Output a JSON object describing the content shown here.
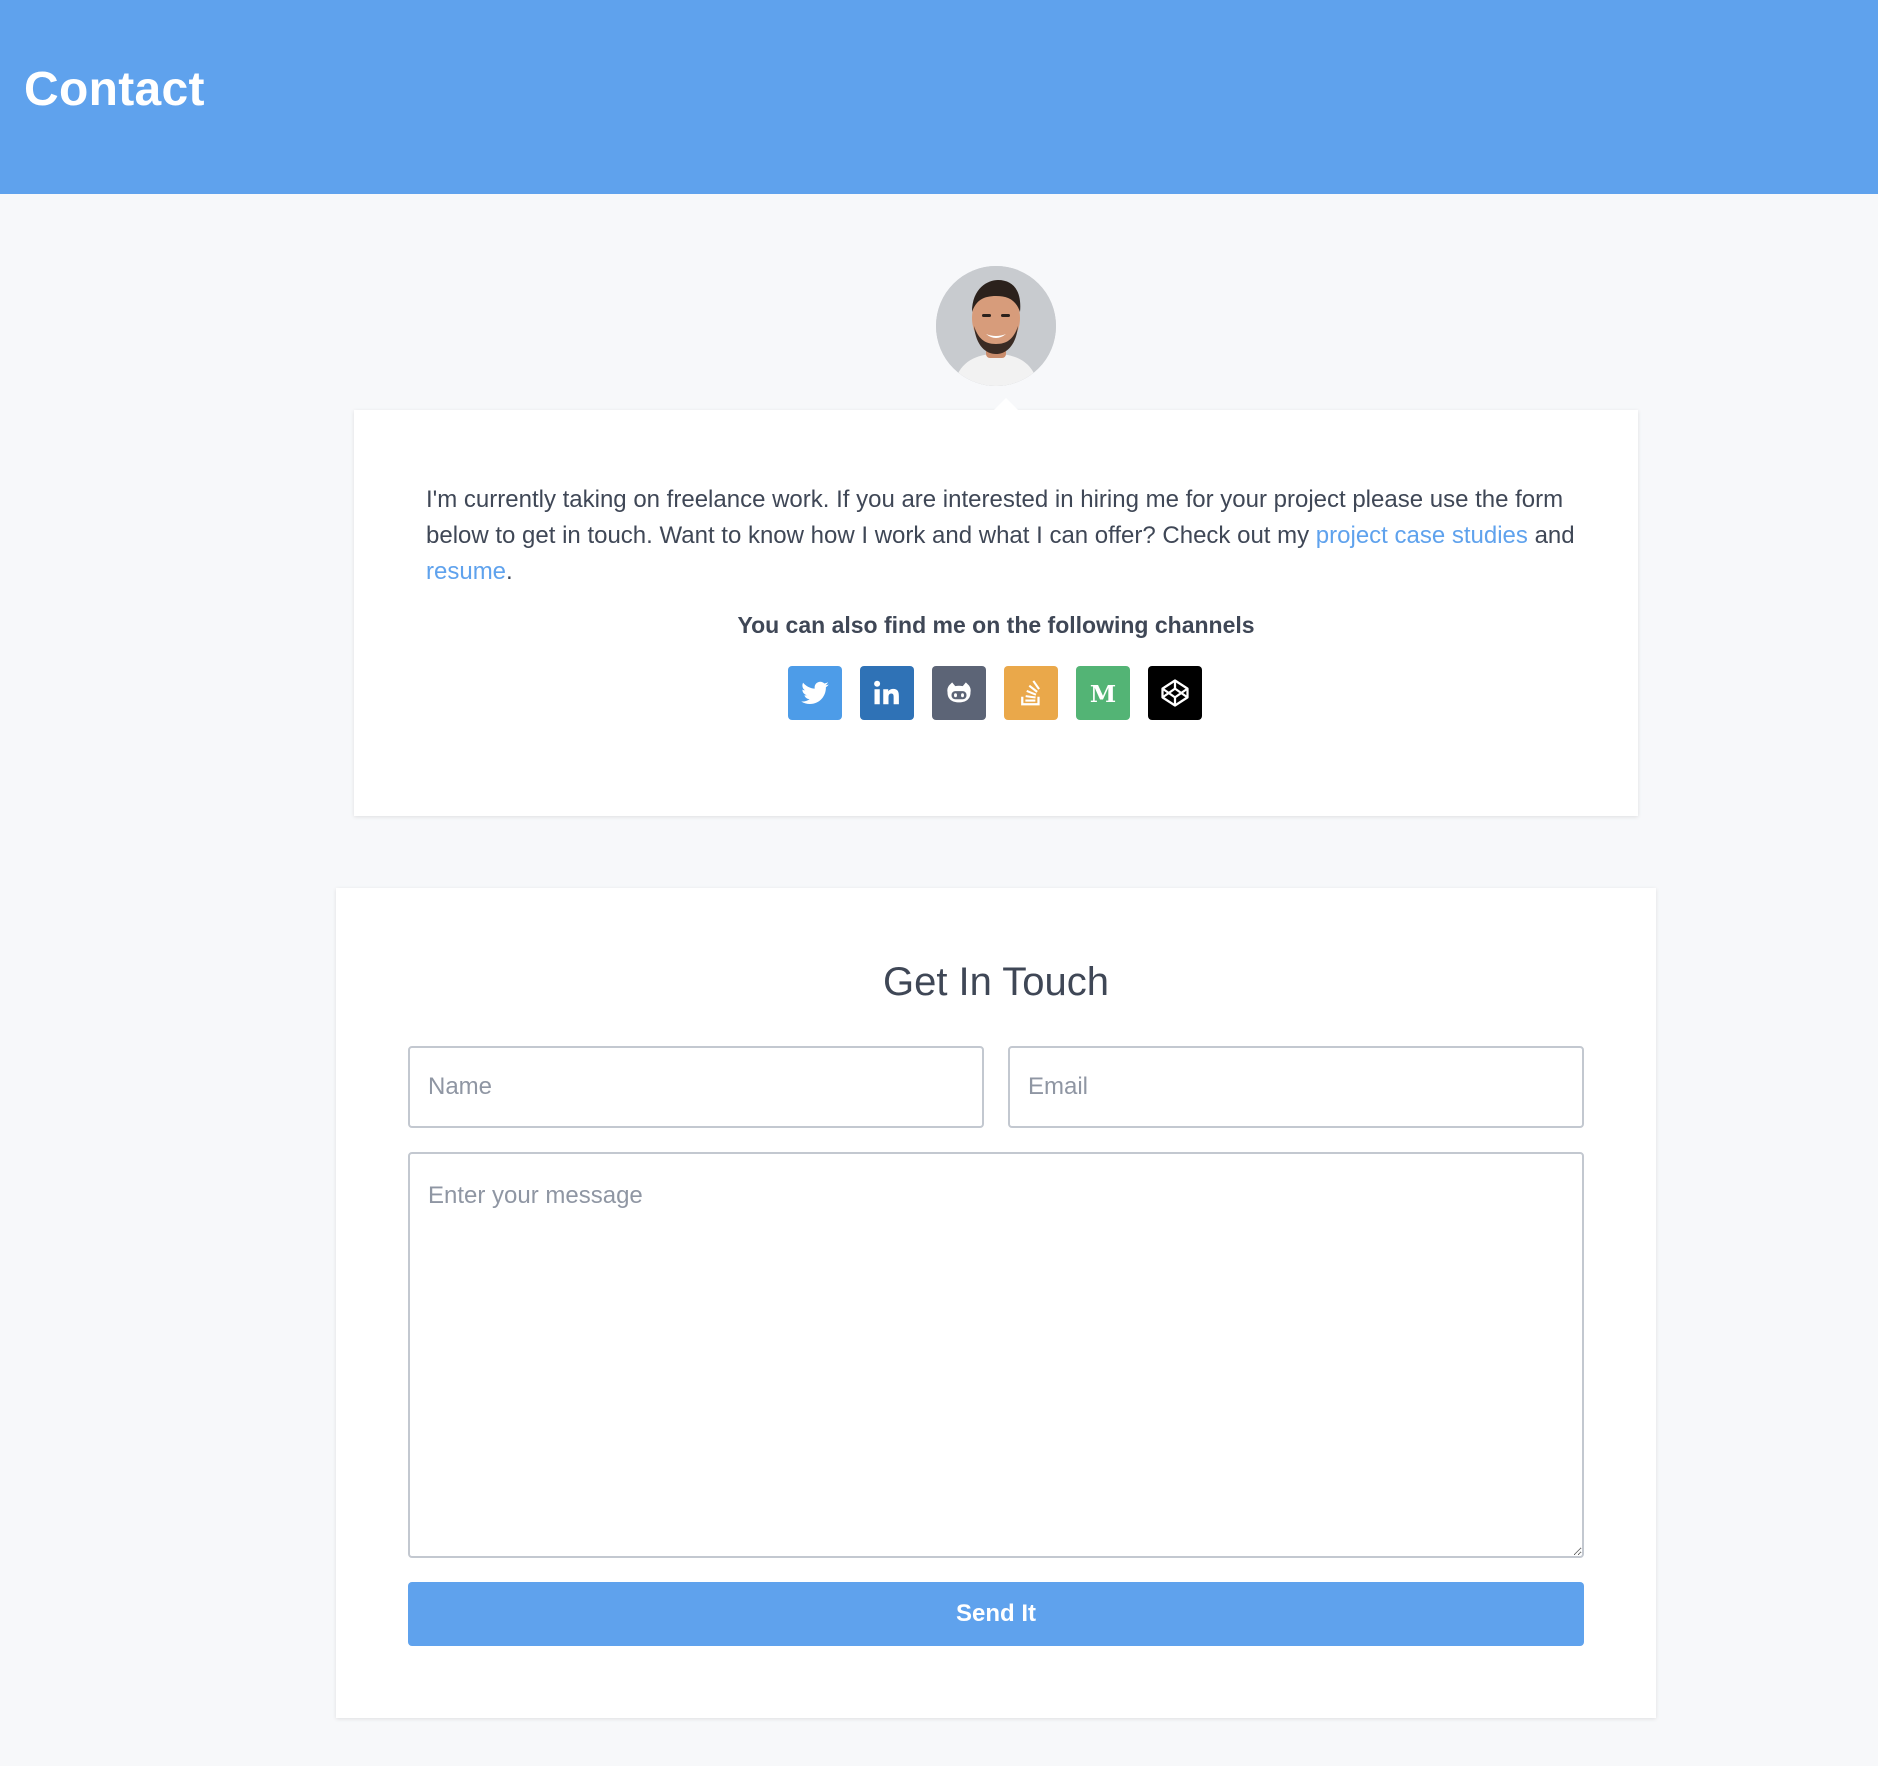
{
  "header": {
    "title": "Contact",
    "background_color": "#5fa2ed"
  },
  "profile": {
    "avatar_icon": "avatar-photo"
  },
  "intro": {
    "text_before": "I'm currently taking on freelance work. If you are interested in hiring me for your project please use the form below to get in touch. Want to know how I work and what I can offer? Check out my ",
    "case_studies_link": "project case studies",
    "text_middle": " and ",
    "resume_link": "resume",
    "text_after": ".",
    "channels_heading": "You can also find me on the following channels",
    "channels": [
      {
        "name": "twitter",
        "icon": "twitter-icon",
        "color": "#4d9ce8"
      },
      {
        "name": "linkedin",
        "icon": "linkedin-icon",
        "color": "#2f72b6"
      },
      {
        "name": "github",
        "icon": "github-icon",
        "color": "#5c6476"
      },
      {
        "name": "stack-overflow",
        "icon": "stack-overflow-icon",
        "color": "#eaa84a"
      },
      {
        "name": "medium",
        "icon": "medium-icon",
        "color": "#53b475"
      },
      {
        "name": "codepen",
        "icon": "codepen-icon",
        "color": "#000000"
      }
    ]
  },
  "form": {
    "title": "Get In Touch",
    "name_placeholder": "Name",
    "email_placeholder": "Email",
    "message_placeholder": "Enter your message",
    "submit_label": "Send It"
  },
  "colors": {
    "accent": "#5fa2ed",
    "page_background": "#f7f8fa",
    "text": "#3f4756"
  }
}
